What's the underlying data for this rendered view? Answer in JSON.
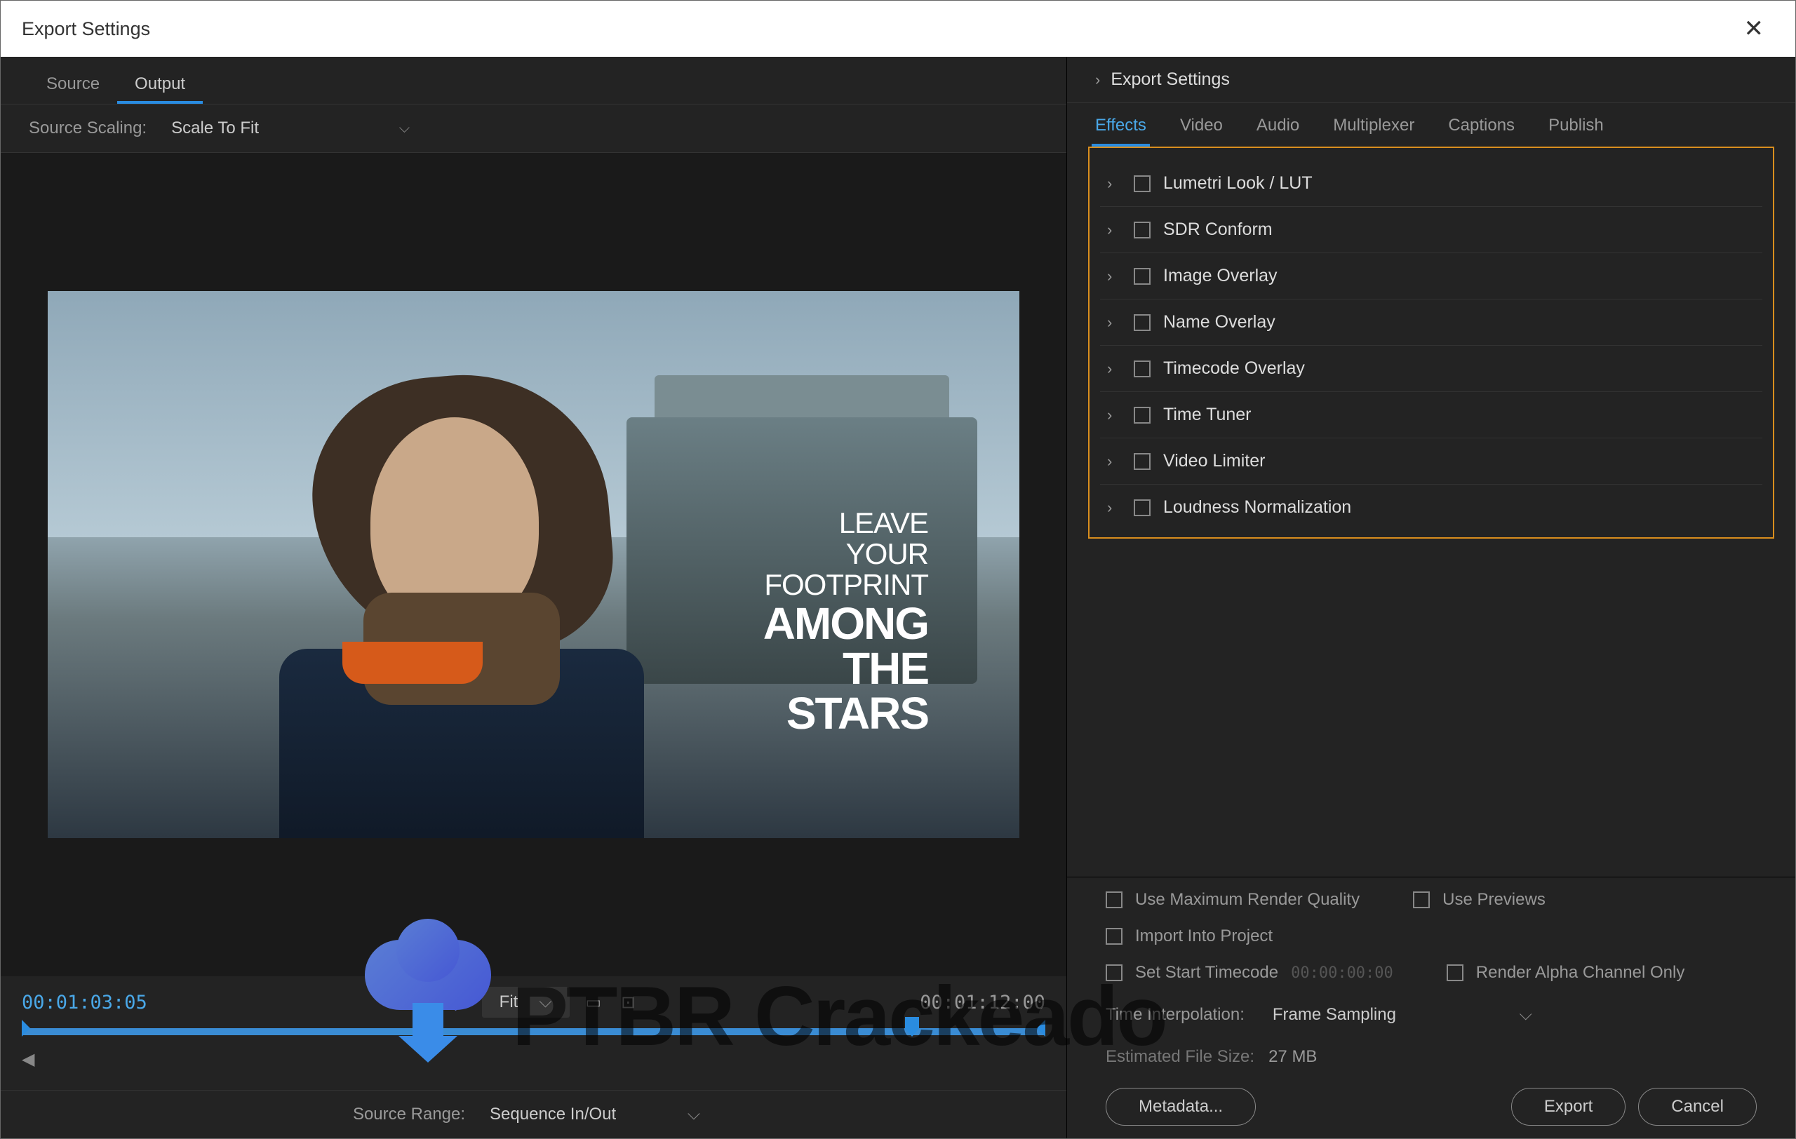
{
  "window": {
    "title": "Export Settings"
  },
  "leftPanel": {
    "tabs": {
      "source": "Source",
      "output": "Output"
    },
    "sourceScaling": {
      "label": "Source Scaling:",
      "value": "Scale To Fit"
    },
    "preview": {
      "line1": "LEAVE",
      "line2": "YOUR",
      "line3": "FOOTPRINT",
      "line4": "AMONG",
      "line5": "THE",
      "line6": "STARS"
    },
    "timeline": {
      "currentTime": "00:01:03:05",
      "endTime": "00:01:12:00",
      "fit": "Fit"
    },
    "sourceRange": {
      "label": "Source Range:",
      "value": "Sequence In/Out"
    }
  },
  "rightPanel": {
    "header": "Export Settings",
    "tabs": {
      "effects": "Effects",
      "video": "Video",
      "audio": "Audio",
      "multiplexer": "Multiplexer",
      "captions": "Captions",
      "publish": "Publish"
    },
    "effects": [
      "Lumetri Look / LUT",
      "SDR Conform",
      "Image Overlay",
      "Name Overlay",
      "Timecode Overlay",
      "Time Tuner",
      "Video Limiter",
      "Loudness Normalization"
    ],
    "options": {
      "maxRender": "Use Maximum Render Quality",
      "previews": "Use Previews",
      "import": "Import Into Project",
      "startTC": "Set Start Timecode",
      "startTCValue": "00:00:00:00",
      "alpha": "Render Alpha Channel Only",
      "interpLabel": "Time Interpolation:",
      "interpValue": "Frame Sampling",
      "estLabel": "Estimated File Size:",
      "estValue": "27 MB"
    },
    "buttons": {
      "metadata": "Metadata...",
      "export": "Export",
      "cancel": "Cancel"
    }
  },
  "watermark": "PTBR Crackeado"
}
